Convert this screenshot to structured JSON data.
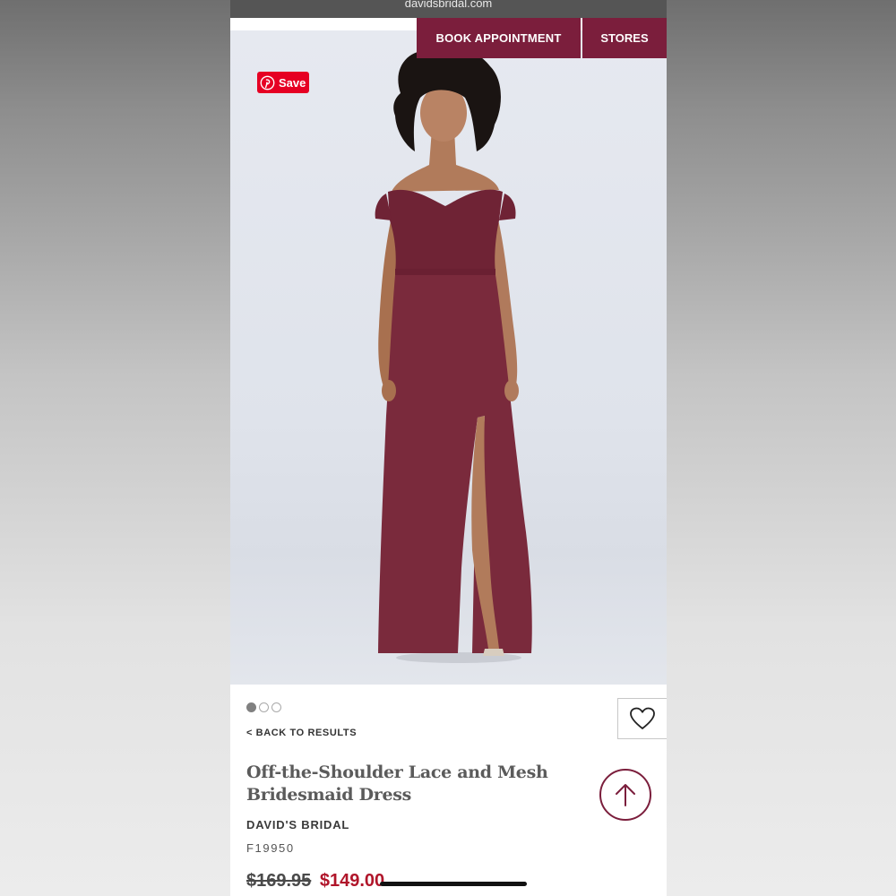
{
  "browser": {
    "url": "davidsbridal.com"
  },
  "nav": {
    "book_label": "BOOK APPOINTMENT",
    "stores_label": "STORES"
  },
  "pinterest": {
    "save_label": "Save"
  },
  "hero": {
    "image_alt": "Model wearing off-the-shoulder wine lace and mesh gown"
  },
  "gallery": {
    "count": 3,
    "active_index": 0
  },
  "product": {
    "back_label": "< BACK TO RESULTS",
    "title": "Off-the-Shoulder Lace and Mesh Bridesmaid Dress",
    "brand": "DAVID'S BRIDAL",
    "sku": "F19950",
    "original_price": "$169.95",
    "sale_price": "$149.00"
  },
  "icons": {
    "wishlist": "heart-icon",
    "back_to_top": "arrow-up-icon",
    "pinterest": "pinterest-icon"
  },
  "colors": {
    "brand": "#7b1e3c",
    "sale": "#b0152a",
    "pinterest": "#e60023",
    "dress": "#7a2a3c"
  }
}
